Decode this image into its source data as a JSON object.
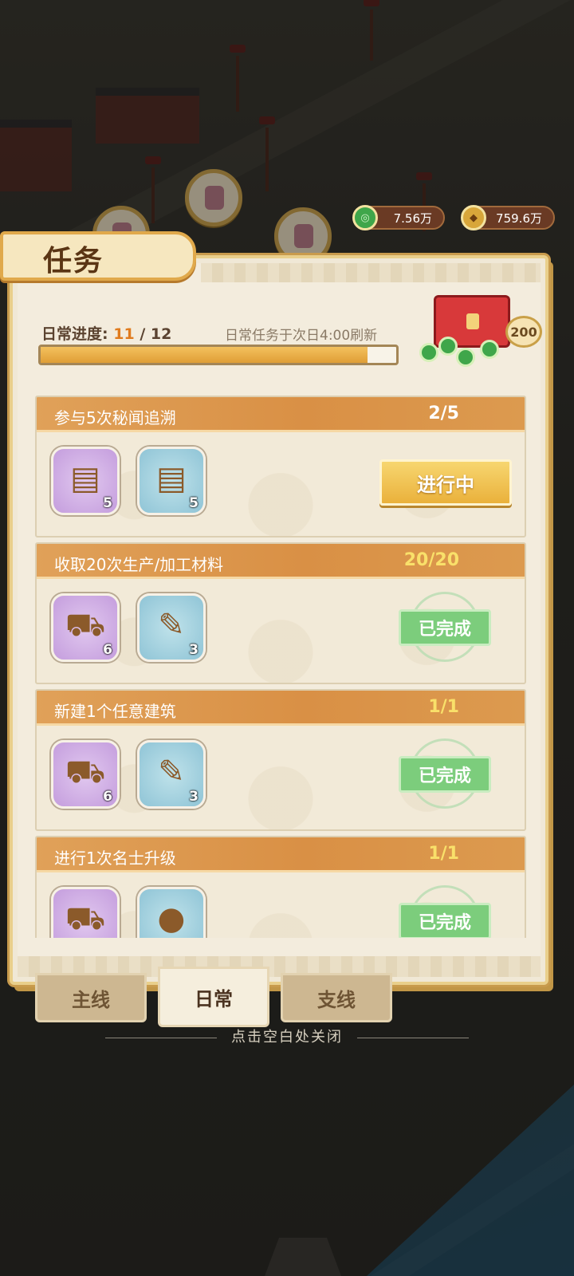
{
  "currency": {
    "jade": {
      "icon": "jade-coin-icon",
      "value": "7.56万"
    },
    "gold": {
      "icon": "gold-coin-icon",
      "value": "759.6万"
    }
  },
  "panel": {
    "title": "任务",
    "progress": {
      "label": "日常进度:",
      "current": "11",
      "sep": "/",
      "total": "12",
      "fraction": 0.92,
      "note": "日常任务于次日4:00刷新"
    },
    "chest": {
      "icon": "treasure-chest-icon",
      "badge": "200"
    }
  },
  "tasks": [
    {
      "title": "参与5次秘闻追溯",
      "count": "2/5",
      "rewards": [
        {
          "icon": "scroll-book-purple-icon",
          "qty": "5"
        },
        {
          "icon": "scroll-book-blue-icon",
          "qty": "5"
        }
      ],
      "status": "in_progress",
      "button": "进行中"
    },
    {
      "title": "收取20次生产/加工材料",
      "count": "20/20",
      "rewards": [
        {
          "icon": "cart-icon",
          "qty": "6"
        },
        {
          "icon": "brush-icon",
          "qty": "3"
        }
      ],
      "status": "done",
      "stamp": "已完成"
    },
    {
      "title": "新建1个任意建筑",
      "count": "1/1",
      "rewards": [
        {
          "icon": "cart-icon",
          "qty": "6"
        },
        {
          "icon": "brush-icon",
          "qty": "3"
        }
      ],
      "status": "done",
      "stamp": "已完成"
    },
    {
      "title": "进行1次名士升级",
      "count": "1/1",
      "rewards": [
        {
          "icon": "cart-icon",
          "qty": ""
        },
        {
          "icon": "pig-coin-icon",
          "qty": ""
        }
      ],
      "status": "done",
      "stamp": "已完成"
    }
  ],
  "tabs": [
    {
      "label": "主线",
      "active": false
    },
    {
      "label": "日常",
      "active": true
    },
    {
      "label": "支线",
      "active": false
    }
  ],
  "close_hint": "点击空白处关闭"
}
